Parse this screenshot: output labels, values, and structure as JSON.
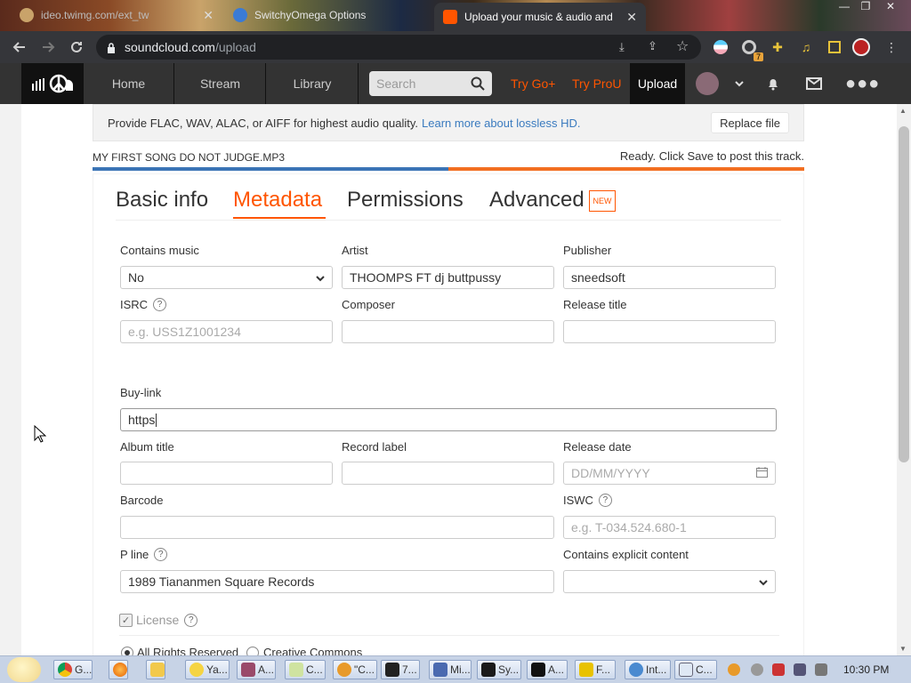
{
  "browser": {
    "tabs": [
      {
        "title": "",
        "subtitle": "ideo.twimg.com/ext_tw"
      },
      {
        "title": "SwitchyOmega Options"
      },
      {
        "title": "Upload your music & audio and"
      }
    ],
    "url_domain": "soundcloud.com",
    "url_path": "/upload",
    "extension_badge": "7"
  },
  "header": {
    "nav": [
      "Home",
      "Stream",
      "Library"
    ],
    "search_placeholder": "Search",
    "promo_go": "Try Go+",
    "promo_pro": "Try ProU",
    "upload": "Upload"
  },
  "banner": {
    "text": "Provide FLAC, WAV, ALAC, or AIFF for highest audio quality.",
    "link": "Learn more about lossless HD.",
    "replace_button": "Replace file"
  },
  "upload": {
    "filename": "MY FIRST SONG DO NOT JUDGE.mp3",
    "status": "Ready. Click Save to post this track.",
    "progress": 1.0
  },
  "tabs": {
    "basic": "Basic info",
    "metadata": "Metadata",
    "permissions": "Permissions",
    "advanced": "Advanced",
    "new_badge": "NEW",
    "active": "Metadata"
  },
  "form": {
    "contains_music": {
      "label": "Contains music",
      "value": "No"
    },
    "artist": {
      "label": "Artist",
      "value": "THOOMPS FT dj buttpussy"
    },
    "publisher": {
      "label": "Publisher",
      "value": "sneedsoft"
    },
    "isrc": {
      "label": "ISRC",
      "placeholder": "e.g. USS1Z1001234"
    },
    "composer": {
      "label": "Composer",
      "value": ""
    },
    "release_title": {
      "label": "Release title",
      "value": ""
    },
    "buy_link": {
      "label": "Buy-link",
      "value": "https"
    },
    "album_title": {
      "label": "Album title",
      "value": ""
    },
    "record_label": {
      "label": "Record label",
      "value": ""
    },
    "release_date": {
      "label": "Release date",
      "placeholder": "DD/MM/YYYY"
    },
    "barcode": {
      "label": "Barcode",
      "value": ""
    },
    "iswc": {
      "label": "ISWC",
      "placeholder": "e.g. T-034.524.680-1"
    },
    "p_line": {
      "label": "P line",
      "value": "1989 Tiananmen Square Records"
    },
    "explicit": {
      "label": "Contains explicit content",
      "value": ""
    },
    "license": {
      "label": "License",
      "checked": true
    },
    "license_options": [
      "All Rights Reserved",
      "Creative Commons"
    ],
    "license_selected": "All Rights Reserved"
  },
  "taskbar": {
    "items": [
      "G...",
      "",
      "",
      "Ya...",
      "A...",
      "C...",
      "\"C...",
      "7...",
      "Mi...",
      "Sy...",
      "A...",
      "F...",
      "Int...",
      "C..."
    ],
    "clock": "10:30 PM"
  },
  "colors": {
    "accent": "#ff5500",
    "link": "#3b7bbf",
    "progress_blue": "#3b74b6",
    "progress_orange": "#f26f21"
  }
}
